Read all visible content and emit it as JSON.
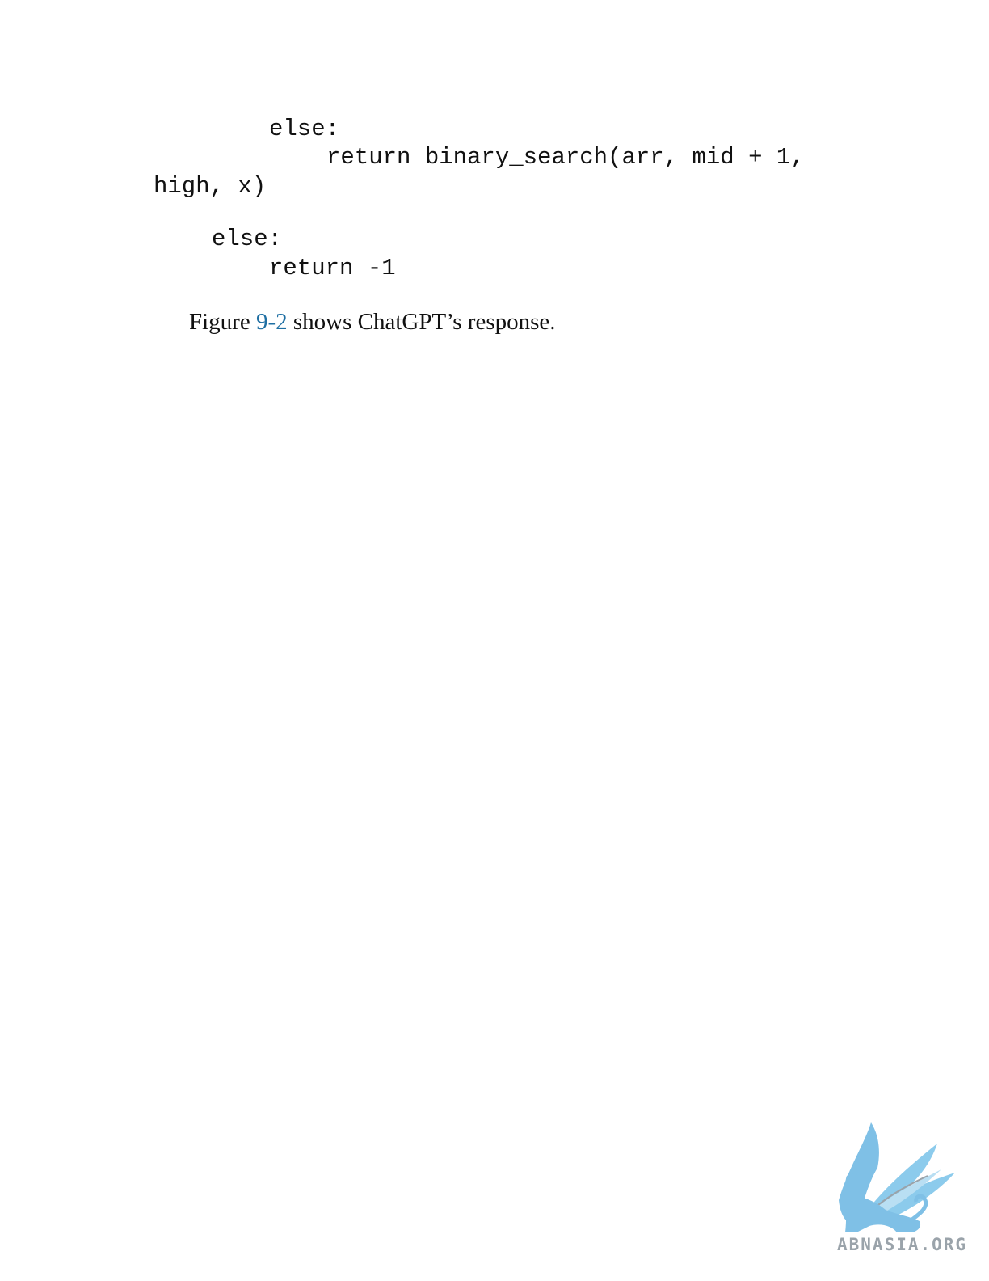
{
  "code": {
    "line1": "else:",
    "line2": "return binary_search(arr, mid + 1,",
    "line3": "high, x)",
    "line4": "else:",
    "line5": "return -1"
  },
  "paragraph": {
    "prefix": "Figure ",
    "link_text": "9-2",
    "suffix": " shows ChatGPT’s response."
  },
  "watermark": {
    "text": "ABNASIA.ORG",
    "color": "#7fc0e6"
  },
  "colors": {
    "link": "#1f6fa3",
    "text": "#111111"
  }
}
